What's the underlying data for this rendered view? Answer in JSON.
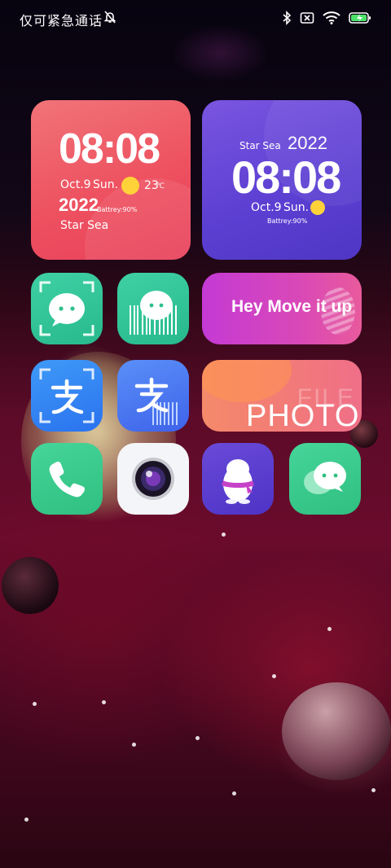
{
  "status_bar": {
    "carrier_text": "仅可紧急通话",
    "icons": [
      "bell-off-icon",
      "bluetooth-icon",
      "sim-missing-icon",
      "wifi-icon",
      "battery-charging-icon"
    ]
  },
  "widgets": {
    "clock_red": {
      "time": "08:08",
      "date": "Oct.9",
      "day": "Sun.",
      "temp_value": "23",
      "temp_unit": "℃",
      "year": "2022",
      "battery": "Battrey:90%",
      "location": "Star Sea",
      "weather_icon": "sun-icon"
    },
    "clock_purple": {
      "location": "Star Sea",
      "year": "2022",
      "time": "08:08",
      "date": "Oct.9",
      "day": "Sun.",
      "battery": "Battrey:90%",
      "weather_icon": "sun-icon"
    },
    "banner_pink": {
      "text": "Hey Move it up"
    },
    "banner_photo": {
      "text": "PHOTO",
      "ghost_text": "FILE"
    }
  },
  "apps": [
    {
      "id": "wechat-scan",
      "icon": "chat-scan-icon"
    },
    {
      "id": "wechat-barcode",
      "icon": "chat-barcode-icon"
    },
    {
      "id": "alipay-scan",
      "icon": "alipay-scan-icon"
    },
    {
      "id": "alipay-barcode",
      "icon": "alipay-barcode-icon"
    },
    {
      "id": "phone",
      "icon": "phone-icon"
    },
    {
      "id": "camera",
      "icon": "camera-icon"
    },
    {
      "id": "qq",
      "icon": "penguin-icon"
    },
    {
      "id": "messages",
      "icon": "chat-bubbles-icon"
    }
  ],
  "colors": {
    "widget_red": "#ee5160",
    "widget_purple": "#5b3fd2",
    "banner_pink": "#d948b8",
    "banner_orange": "#f27a78",
    "app_green": "#2fbf80",
    "app_blue": "#2a72ef"
  }
}
